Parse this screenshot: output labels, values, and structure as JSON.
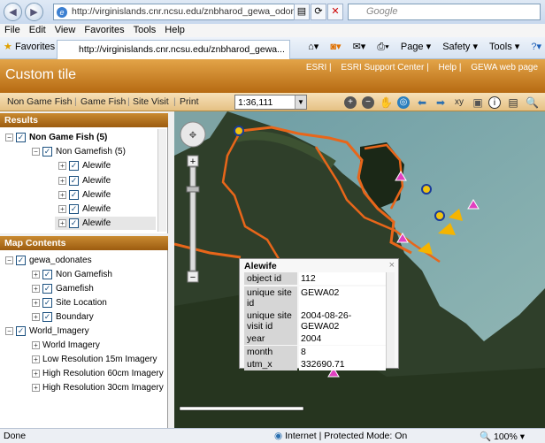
{
  "browser": {
    "url": "http://virginislands.cnr.ncsu.edu/znbharod_gewa_odonates/",
    "search_placeholder": "Google",
    "menu": [
      "File",
      "Edit",
      "View",
      "Favorites",
      "Tools",
      "Help"
    ],
    "favorites_label": "Favorites",
    "tab_title": "http://virginislands.cnr.ncsu.edu/znbharod_gewa...",
    "commands": [
      "Page ▾",
      "Safety ▾",
      "Tools ▾"
    ]
  },
  "app": {
    "title": "Custom tile",
    "links": [
      "ESRI",
      "ESRI Support Center",
      "Help",
      "GEWA web page"
    ]
  },
  "toolbar": {
    "links": [
      "Non Game Fish",
      "Game Fish",
      "Site Visit",
      "Print"
    ],
    "scale": "1:36,111"
  },
  "results": {
    "header": "Results",
    "root": "Non Game Fish (5)",
    "child": "Non Gamefish (5)",
    "items": [
      "Alewife",
      "Alewife",
      "Alewife",
      "Alewife",
      "Alewife"
    ]
  },
  "map_contents": {
    "header": "Map Contents",
    "layer1": "gewa_odonates",
    "layer1_items": [
      "Non Gamefish",
      "Gamefish",
      "Site Location",
      "Boundary"
    ],
    "layer2": "World_Imagery",
    "layer2_items": [
      "World Imagery",
      "Low Resolution 15m Imagery",
      "High Resolution 60cm Imagery",
      "High Resolution 30cm Imagery"
    ]
  },
  "popup": {
    "title": "Alewife",
    "fields": [
      {
        "k": "object id",
        "v": "112"
      },
      {
        "k": "unique site id",
        "v": "GEWA02"
      },
      {
        "k": "unique site visit id",
        "v": "2004-08-26-GEWA02"
      },
      {
        "k": "year",
        "v": "2004"
      },
      {
        "k": "month",
        "v": "8"
      },
      {
        "k": "utm_x",
        "v": "332690.71"
      }
    ]
  },
  "status": {
    "left": "Done",
    "zone": "Internet | Protected Mode: On",
    "zoom": "100%"
  },
  "colors": {
    "header": "#c98a31",
    "boundary": "#e8661a"
  }
}
